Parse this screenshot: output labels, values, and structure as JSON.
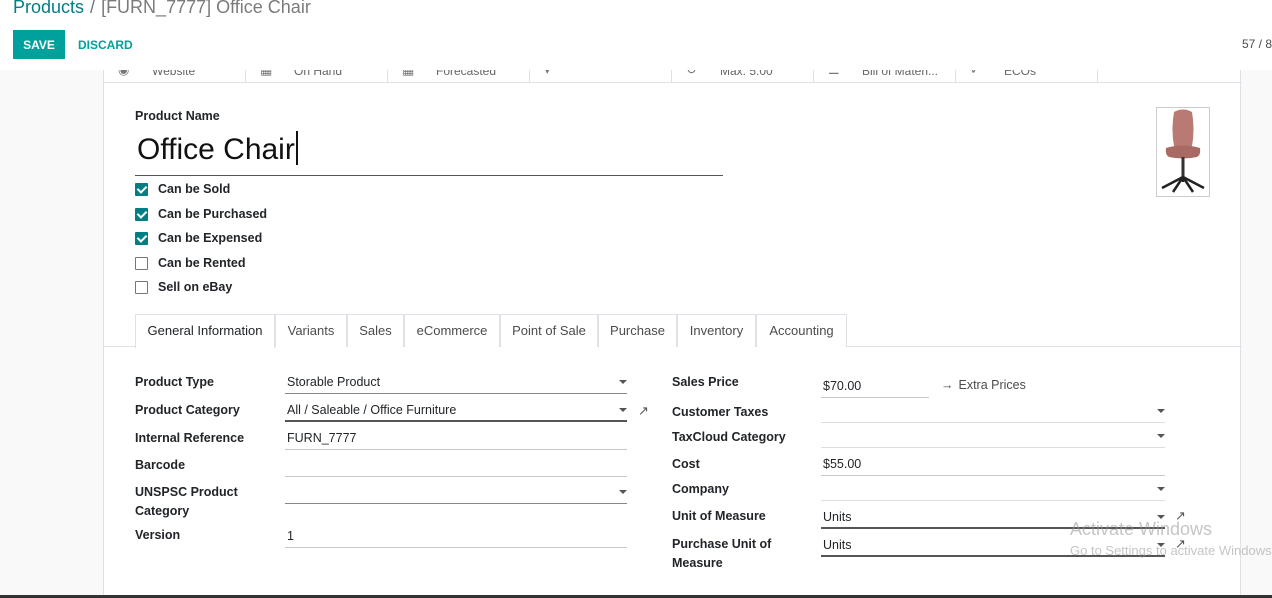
{
  "breadcrumb": {
    "parent": "Products",
    "separator": "/",
    "current": "[FURN_7777] Office Chair"
  },
  "toolbar": {
    "save_label": "SAVE",
    "discard_label": "DISCARD",
    "pager": "57 / 8"
  },
  "smart_buttons": [
    {
      "label": "Website",
      "icon": "globe-icon"
    },
    {
      "label": "On Hand",
      "icon": "cubes-icon"
    },
    {
      "label": "Forecasted",
      "icon": "cubes-icon"
    },
    {
      "label": "",
      "icon": "dropdown-icon"
    },
    {
      "label": "Max:   5.00",
      "icon": "refresh-icon"
    },
    {
      "label": "Bill of Materi...",
      "icon": "list-icon"
    },
    {
      "label": "ECOs",
      "icon": "check-icon"
    }
  ],
  "product": {
    "name_label": "Product Name",
    "name": "Office Chair",
    "image_icon": "office-chair-image"
  },
  "checkboxes": [
    {
      "label": "Can be Sold",
      "checked": true
    },
    {
      "label": "Can be Purchased",
      "checked": true
    },
    {
      "label": "Can be Expensed",
      "checked": true
    },
    {
      "label": "Can be Rented",
      "checked": false
    },
    {
      "label": "Sell on eBay",
      "checked": false
    }
  ],
  "tabs": [
    "General Information",
    "Variants",
    "Sales",
    "eCommerce",
    "Point of Sale",
    "Purchase",
    "Inventory",
    "Accounting"
  ],
  "active_tab": "General Information",
  "left_fields": {
    "product_type": {
      "label": "Product Type",
      "value": "Storable Product"
    },
    "product_category": {
      "label": "Product Category",
      "value": "All / Saleable / Office Furniture"
    },
    "internal_reference": {
      "label": "Internal Reference",
      "value": "FURN_7777"
    },
    "barcode": {
      "label": "Barcode",
      "value": ""
    },
    "unspsc": {
      "label": "UNSPSC Product Category",
      "value": ""
    },
    "version": {
      "label": "Version",
      "value": "1"
    }
  },
  "right_fields": {
    "sales_price": {
      "label": "Sales Price",
      "value": "$70.00"
    },
    "extra_prices": "Extra Prices",
    "customer_taxes": {
      "label": "Customer Taxes",
      "value": ""
    },
    "taxcloud_category": {
      "label": "TaxCloud Category",
      "value": ""
    },
    "cost": {
      "label": "Cost",
      "value": "$55.00"
    },
    "company": {
      "label": "Company",
      "value": ""
    },
    "uom": {
      "label": "Unit of Measure",
      "value": "Units"
    },
    "purchase_uom": {
      "label": "Purchase Unit of Measure",
      "value": "Units"
    }
  },
  "watermark": {
    "line1": "Activate Windows",
    "line2": "Go to Settings to activate Windows."
  },
  "colors": {
    "brand": "#00a09d",
    "link": "#017e84"
  }
}
